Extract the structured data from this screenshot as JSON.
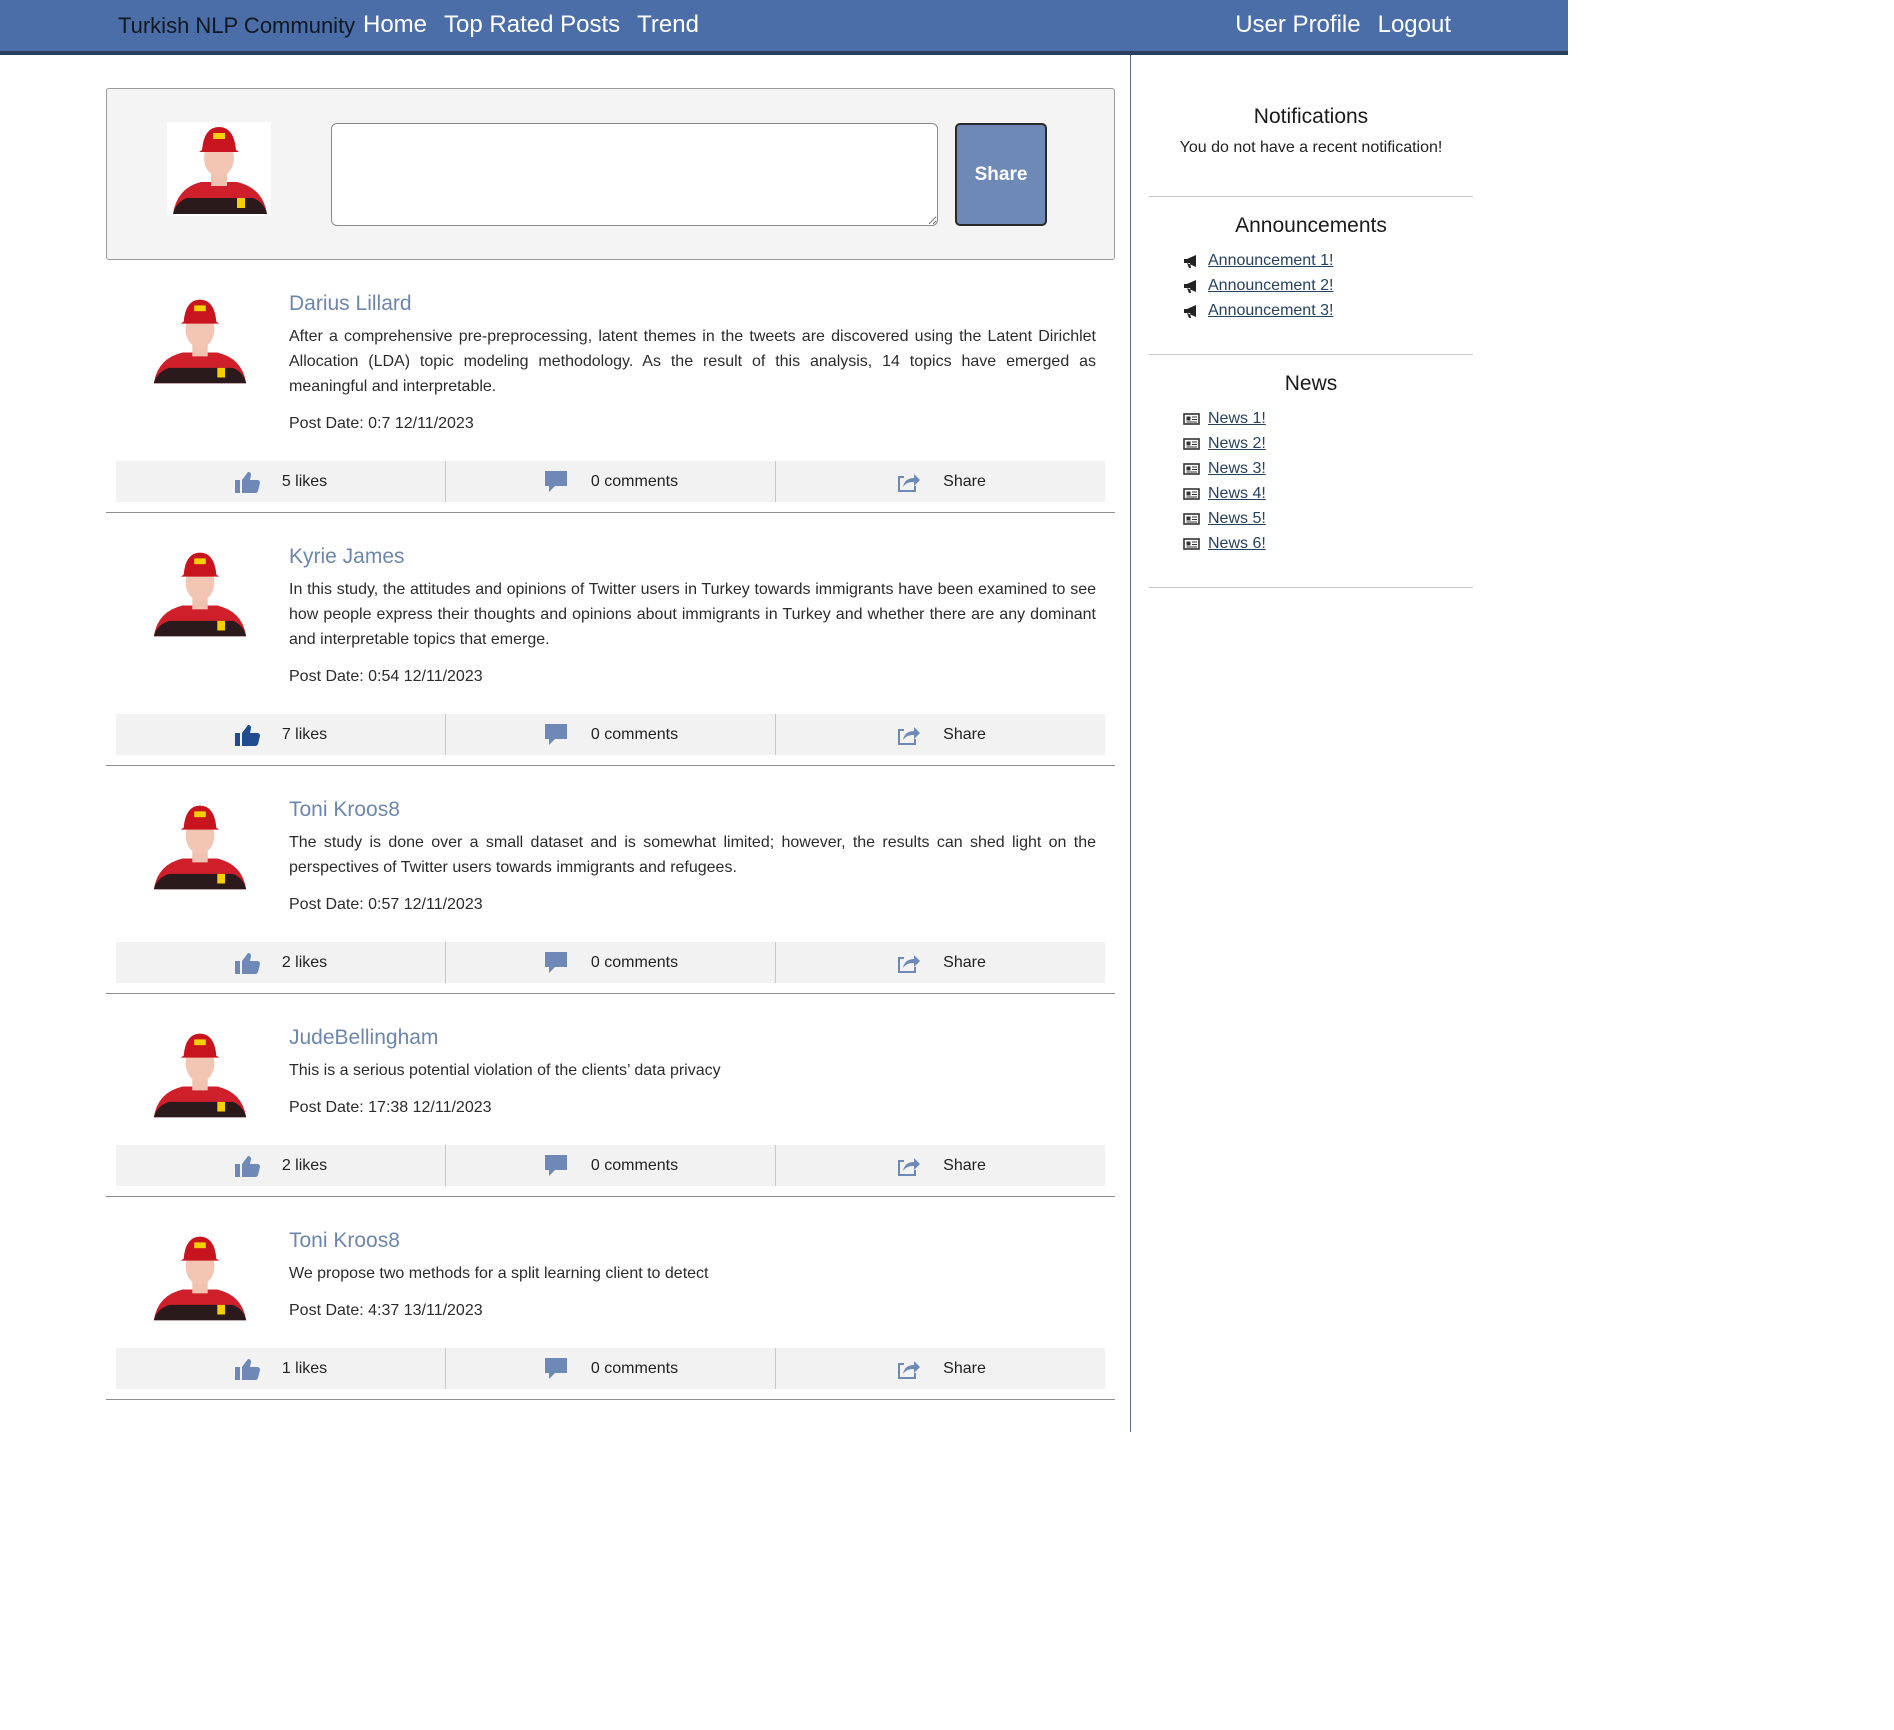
{
  "nav": {
    "brand": "Turkish NLP Community",
    "links": [
      "Home",
      "Top Rated Posts",
      "Trend"
    ],
    "right": [
      "User Profile",
      "Logout"
    ]
  },
  "composer": {
    "placeholder": "",
    "share_label": "Share"
  },
  "posts": [
    {
      "author": "Darius Lillard",
      "text": "After a comprehensive pre-preprocessing, latent themes in the tweets are discovered using the Latent Dirichlet Allocation (LDA) topic modeling methodology. As the result of this analysis, 14 topics have emerged as meaningful and interpretable.",
      "date": "Post Date: 0:7 12/11/2023",
      "likes": "5 likes",
      "comments": "0 comments",
      "share": "Share",
      "liked": false
    },
    {
      "author": "Kyrie James",
      "text": "In this study, the attitudes and opinions of Twitter users in Turkey towards immigrants have been examined to see how people express their thoughts and opinions about immigrants in Turkey and whether there are any dominant and interpretable topics that emerge.",
      "date": "Post Date: 0:54 12/11/2023",
      "likes": "7 likes",
      "comments": "0 comments",
      "share": "Share",
      "liked": true
    },
    {
      "author": "Toni Kroos8",
      "text": "The study is done over a small dataset and is somewhat limited; however, the results can shed light on the perspectives of Twitter users towards immigrants and refugees.",
      "date": "Post Date: 0:57 12/11/2023",
      "likes": "2 likes",
      "comments": "0 comments",
      "share": "Share",
      "liked": false
    },
    {
      "author": "JudeBellingham",
      "text": "This is a serious potential violation of the clients’ data privacy",
      "date": "Post Date: 17:38 12/11/2023",
      "likes": "2 likes",
      "comments": "0 comments",
      "share": "Share",
      "liked": false
    },
    {
      "author": "Toni Kroos8",
      "text": "We propose two methods for a split learning client to detect",
      "date": "Post Date: 4:37 13/11/2023",
      "likes": "1 likes",
      "comments": "0 comments",
      "share": "Share",
      "liked": false
    }
  ],
  "sidebar": {
    "notifications": {
      "title": "Notifications",
      "message": "You do not have a recent notification!"
    },
    "announcements": {
      "title": "Announcements",
      "items": [
        "Announcement 1!",
        "Announcement 2!",
        "Announcement 3!"
      ]
    },
    "news": {
      "title": "News",
      "items": [
        "News 1!",
        "News 2!",
        "News 3!",
        "News 4!",
        "News 5!",
        "News 6!"
      ]
    }
  },
  "colors": {
    "navbar": "#4b6ea8",
    "accent": "#6d86ad",
    "icon": "#6f89b6",
    "icon_active": "#1e4c8e"
  }
}
